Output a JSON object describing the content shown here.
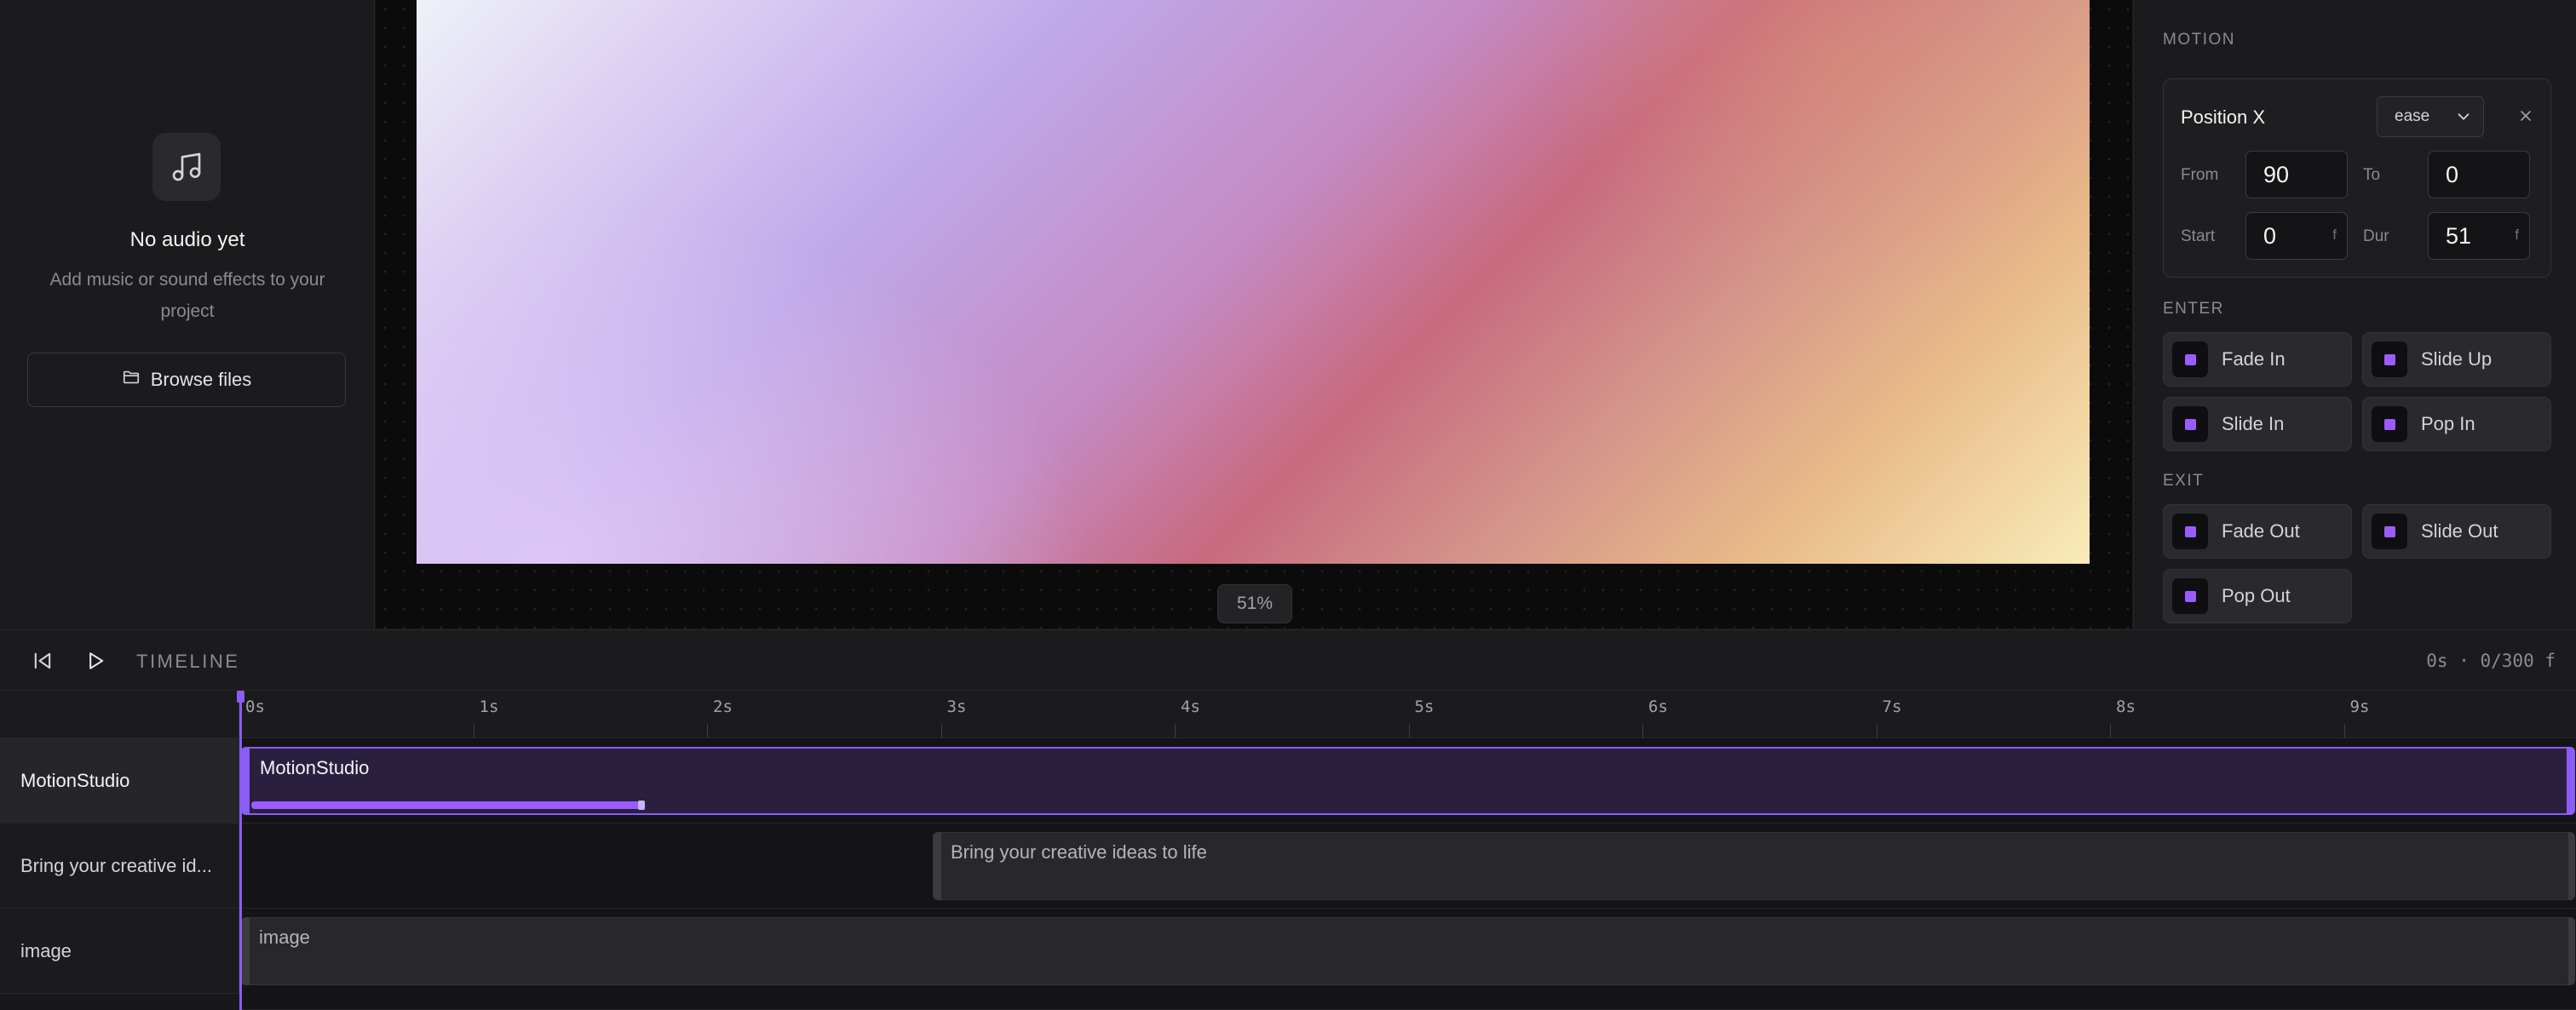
{
  "audio_panel": {
    "title": "No audio yet",
    "description": "Add music or sound effects to your project",
    "browse_label": "Browse files"
  },
  "canvas": {
    "zoom": "51%"
  },
  "motion": {
    "section_title": "MOTION",
    "property_name": "Position X",
    "easing": "ease",
    "from_label": "From",
    "from_value": "90",
    "to_label": "To",
    "to_value": "0",
    "start_label": "Start",
    "start_value": "0",
    "dur_label": "Dur",
    "dur_value": "51",
    "frame_unit": "f"
  },
  "enter": {
    "title": "ENTER",
    "presets": [
      "Fade In",
      "Slide Up",
      "Slide In",
      "Pop In"
    ]
  },
  "exit": {
    "title": "EXIT",
    "presets": [
      "Fade Out",
      "Slide Out",
      "Pop Out"
    ]
  },
  "timeline": {
    "label": "TIMELINE",
    "time_readout": "0s · 0/300 f",
    "ticks": [
      "0s",
      "1s",
      "2s",
      "3s",
      "4s",
      "5s",
      "6s",
      "7s",
      "8s",
      "9s"
    ],
    "tracks": [
      {
        "label": "MotionStudio",
        "clip_label": "MotionStudio"
      },
      {
        "label": "Bring your creative id...",
        "clip_label": "Bring your creative ideas to life"
      },
      {
        "label": "image",
        "clip_label": "image"
      }
    ]
  },
  "colors": {
    "accent": "#8b5cf6",
    "panel_bg": "#1b1b1e",
    "canvas_bg": "#0b0b0c"
  }
}
